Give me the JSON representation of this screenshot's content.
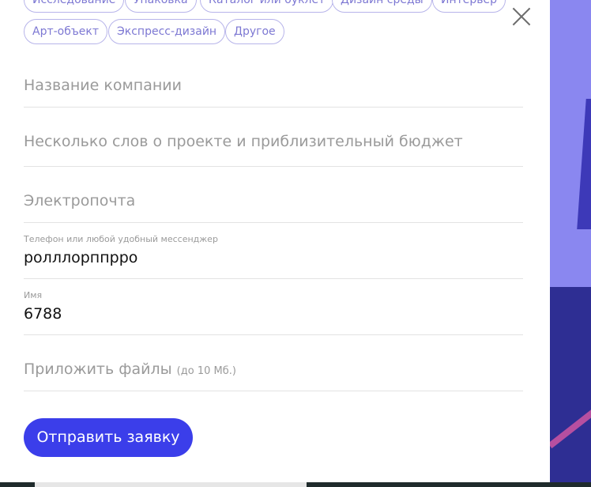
{
  "tags_row1": [
    "Исследование",
    "Упаковка",
    "Каталог или буклет",
    "Дизайн среды",
    "Интерьер"
  ],
  "tags_row2": [
    "Арт-объект",
    "Экспресс-дизайн",
    "Другое"
  ],
  "form": {
    "company": {
      "placeholder": "Название компании"
    },
    "project": {
      "placeholder": "Несколько слов о проекте и приблизительный бюджет"
    },
    "email": {
      "placeholder": "Электропочта"
    },
    "phone": {
      "label": "Телефон или любой удобный мессенджер",
      "value": "ролллорппрро"
    },
    "name": {
      "label": "Имя",
      "value": "6788"
    },
    "files": {
      "label": "Приложить файлы",
      "note": "(до 10 Мб.)"
    },
    "submit_label": "Отправить заявку"
  },
  "colors": {
    "accent": "#3b3eea",
    "tag_border": "#b7b4ea",
    "tag_text": "#7d78d3",
    "bg_top": "#8a87f0",
    "bg_bottom": "#2e2e93"
  },
  "icons": {
    "close": "close-icon"
  }
}
